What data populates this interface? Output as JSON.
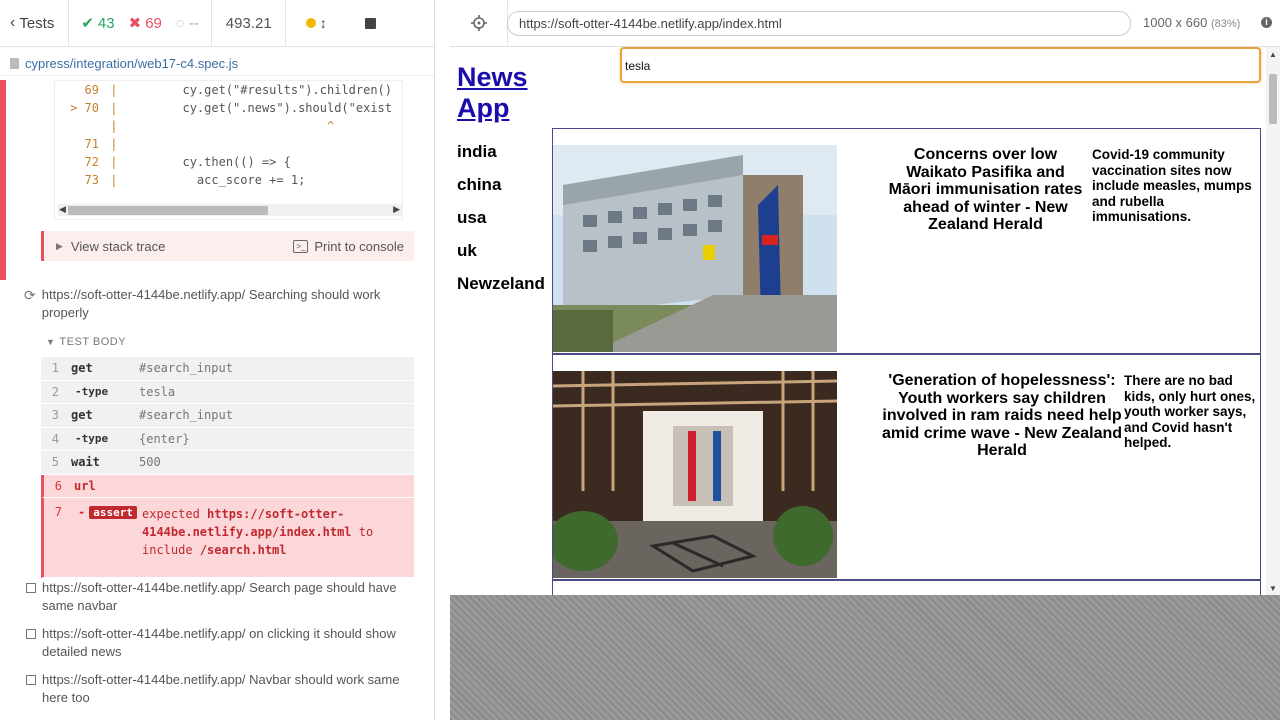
{
  "runner": {
    "tests_label": "Tests",
    "passed": "43",
    "failed": "69",
    "pending": "--",
    "duration": "493.21"
  },
  "spec": {
    "path": "cypress/integration/web17-c4.spec.js"
  },
  "code_frame": {
    "lines": [
      {
        "num": "69",
        "marker": "",
        "text": "        cy.get(\"#results\").children()"
      },
      {
        "num": "70",
        "marker": ">",
        "text": "        cy.get(\".news\").should(\"exist"
      },
      {
        "num": "",
        "marker": "",
        "text": "                            ^"
      },
      {
        "num": "71",
        "marker": "",
        "text": ""
      },
      {
        "num": "72",
        "marker": "",
        "text": "        cy.then(() => {"
      },
      {
        "num": "73",
        "marker": "",
        "text": "          acc_score += 1;"
      }
    ]
  },
  "stack": {
    "view_label": "View stack trace",
    "print_label": "Print to console"
  },
  "current_test": {
    "title": "https://soft-otter-4144be.netlify.app/ Searching should work properly",
    "body_label": "TEST BODY",
    "commands": [
      {
        "num": "1",
        "name": "get",
        "arg": "#search_input"
      },
      {
        "num": "2",
        "name": "-type",
        "arg": "tesla"
      },
      {
        "num": "3",
        "name": "get",
        "arg": "#search_input"
      },
      {
        "num": "4",
        "name": "-type",
        "arg": "{enter}"
      },
      {
        "num": "5",
        "name": "wait",
        "arg": "500"
      },
      {
        "num": "6",
        "name": "url",
        "arg": ""
      }
    ],
    "assert": {
      "num": "7",
      "prefix": "-",
      "badge": "assert",
      "expected_label": "expected",
      "actual": "https://soft-otter-4144be.netlify.app/index.html",
      "to_include_label": "to include",
      "expected_value": "/search.html"
    }
  },
  "other_tests": [
    "https://soft-otter-4144be.netlify.app/ Search page should have same navbar",
    "https://soft-otter-4144be.netlify.app/ on clicking it should show detailed news",
    "https://soft-otter-4144be.netlify.app/ Navbar should work same here too"
  ],
  "aut": {
    "url": "https://soft-otter-4144be.netlify.app/index.html",
    "viewport": "1000 x 660",
    "zoom": "(83%)"
  },
  "app": {
    "logo_line1": "News",
    "logo_line2": "App",
    "search_value": "tesla",
    "nav": [
      "india",
      "china",
      "usa",
      "uk",
      "Newzeland"
    ],
    "news": [
      {
        "title": "Concerns over low Waikato Pasifika and Māori immunisation rates ahead of winter - New Zealand Herald",
        "description": "Covid-19 community vaccination sites now include measles, mumps and rubella immunisations."
      },
      {
        "title": "'Generation of hopelessness': Youth workers say children involved in ram raids need help amid crime wave - New Zealand Herald",
        "description": "There are no bad kids, only hurt ones, youth worker says, and Covid hasn't helped."
      }
    ]
  },
  "colors": {
    "pass": "#26a65b",
    "fail": "#e94f5f",
    "link": "#1a0dab",
    "search_focus": "#e8a33a"
  }
}
